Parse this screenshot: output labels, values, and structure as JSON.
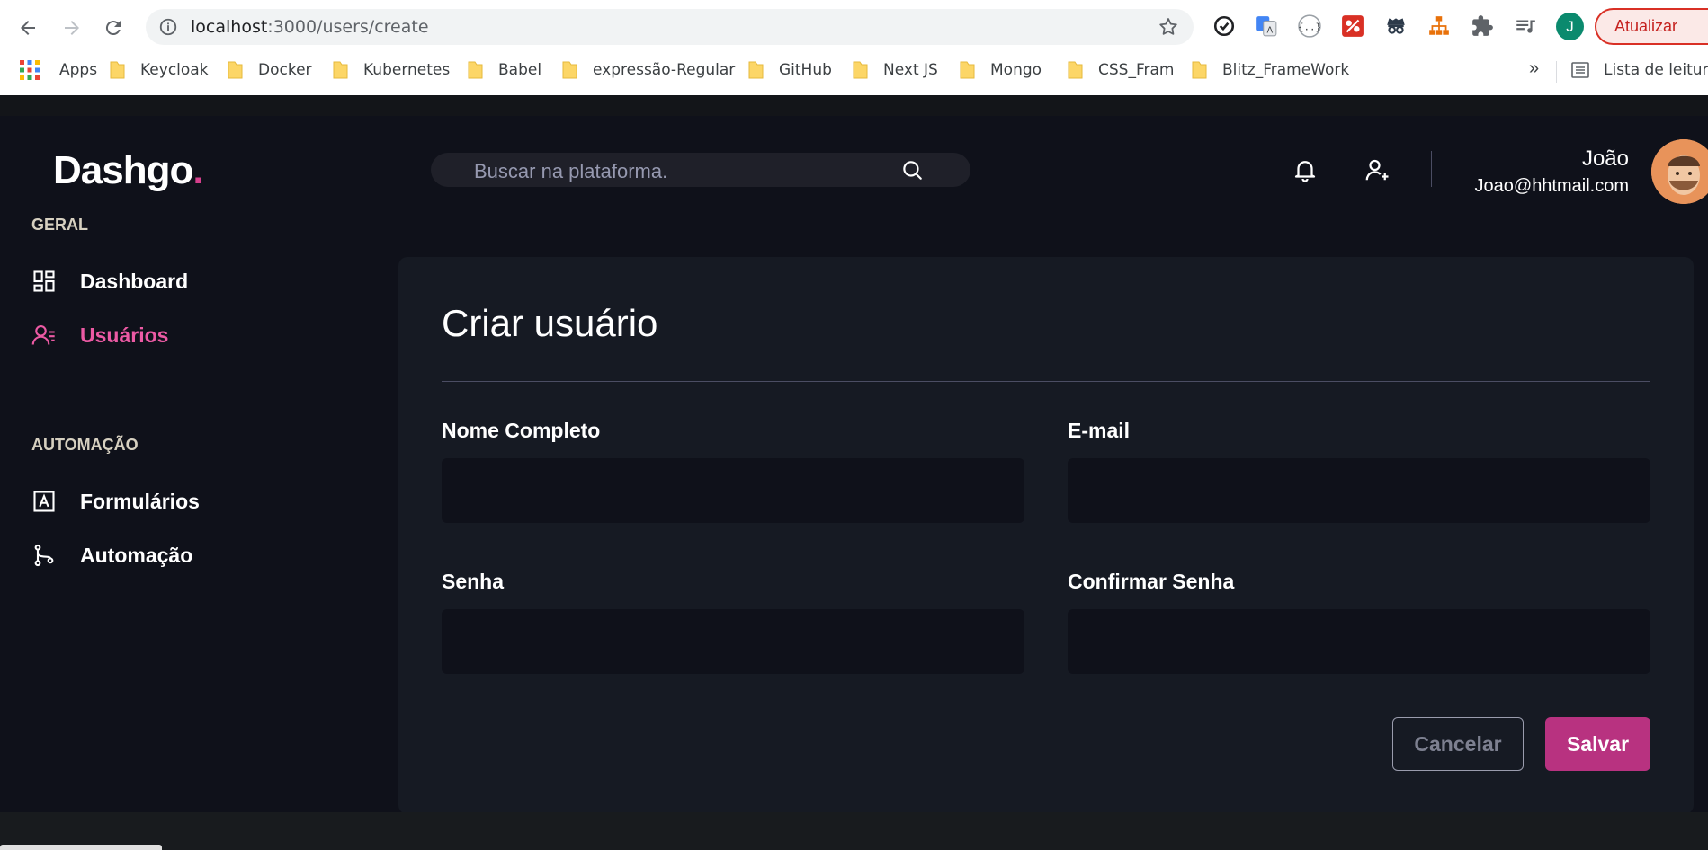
{
  "browser": {
    "url_host": "localhost",
    "url_path": ":3000/users/create",
    "profile_initial": "J",
    "update_label": "Atualizar",
    "bookmarks": [
      {
        "label": "Apps",
        "icon": "apps-icon"
      },
      {
        "label": "Keycloak",
        "icon": "folder-icon"
      },
      {
        "label": "Docker",
        "icon": "folder-icon"
      },
      {
        "label": "Kubernetes",
        "icon": "folder-icon"
      },
      {
        "label": "Babel",
        "icon": "folder-icon"
      },
      {
        "label": "expressão-Regular",
        "icon": "folder-icon"
      },
      {
        "label": "GitHub",
        "icon": "folder-icon"
      },
      {
        "label": "Next JS",
        "icon": "folder-icon"
      },
      {
        "label": "Mongo",
        "icon": "folder-icon"
      },
      {
        "label": "CSS_Fram",
        "icon": "folder-icon"
      },
      {
        "label": "Blitz_FrameWork",
        "icon": "folder-icon"
      }
    ],
    "more_bookmarks": "»",
    "reading_list": "Lista de leitura"
  },
  "header": {
    "logo_text": "Dashgo",
    "logo_dot": ".",
    "search_placeholder": "Buscar na plataforma.",
    "user_name": "João",
    "user_email": "Joao@hhtmail.com"
  },
  "sidebar": {
    "sections": [
      {
        "title": "GERAL",
        "items": [
          {
            "label": "Dashboard",
            "icon": "dashboard-icon",
            "active": false
          },
          {
            "label": "Usuários",
            "icon": "users-icon",
            "active": true
          }
        ]
      },
      {
        "title": "AUTOMAÇÃO",
        "items": [
          {
            "label": "Formulários",
            "icon": "form-icon",
            "active": false
          },
          {
            "label": "Automação",
            "icon": "git-branch-icon",
            "active": false
          }
        ]
      }
    ]
  },
  "form": {
    "title": "Criar usuário",
    "fields": {
      "name_label": "Nome Completo",
      "email_label": "E-mail",
      "password_label": "Senha",
      "confirm_label": "Confirmar Senha"
    },
    "cancel_label": "Cancelar",
    "save_label": "Salvar"
  },
  "colors": {
    "accent": "#d53f8c",
    "button": "#b83280",
    "background": "#0f111a",
    "card": "#161a23"
  }
}
